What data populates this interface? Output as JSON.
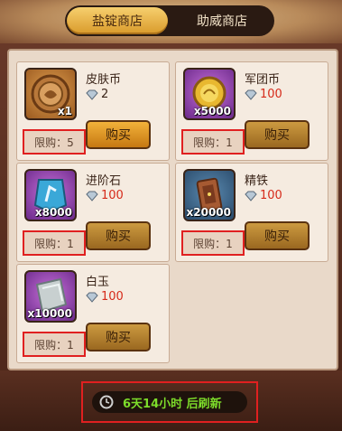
{
  "tabs": [
    {
      "label": "盐锭商店",
      "active": true
    },
    {
      "label": "助威商店",
      "active": false
    }
  ],
  "items": [
    {
      "name": "皮肤币",
      "count": "x1",
      "price": "2",
      "price_color": "#3a2418",
      "limit": "限购：5",
      "buy_label": "购买",
      "icon": "skin-coin-icon"
    },
    {
      "name": "军团币",
      "count": "x5000",
      "price": "100",
      "price_color": "#d62a1a",
      "limit": "限购：1",
      "buy_label": "购买",
      "icon": "legion-coin-icon"
    },
    {
      "name": "进阶石",
      "count": "x8000",
      "price": "100",
      "price_color": "#d62a1a",
      "limit": "限购：1",
      "buy_label": "购买",
      "icon": "advance-stone-icon"
    },
    {
      "name": "精铁",
      "count": "x20000",
      "price": "100",
      "price_color": "#d62a1a",
      "limit": "限购：1",
      "buy_label": "购买",
      "icon": "refined-iron-icon"
    },
    {
      "name": "白玉",
      "count": "x10000",
      "price": "100",
      "price_color": "#d62a1a",
      "limit": "限购：1",
      "buy_label": "购买",
      "icon": "white-jade-icon"
    }
  ],
  "footer": {
    "refresh_text": "6天14小时 后刷新"
  },
  "colors": {
    "accent_gold": "#f2b23a",
    "price_red": "#d62a1a",
    "timer_green": "#7ddc2a",
    "highlight_red": "#e02020"
  }
}
